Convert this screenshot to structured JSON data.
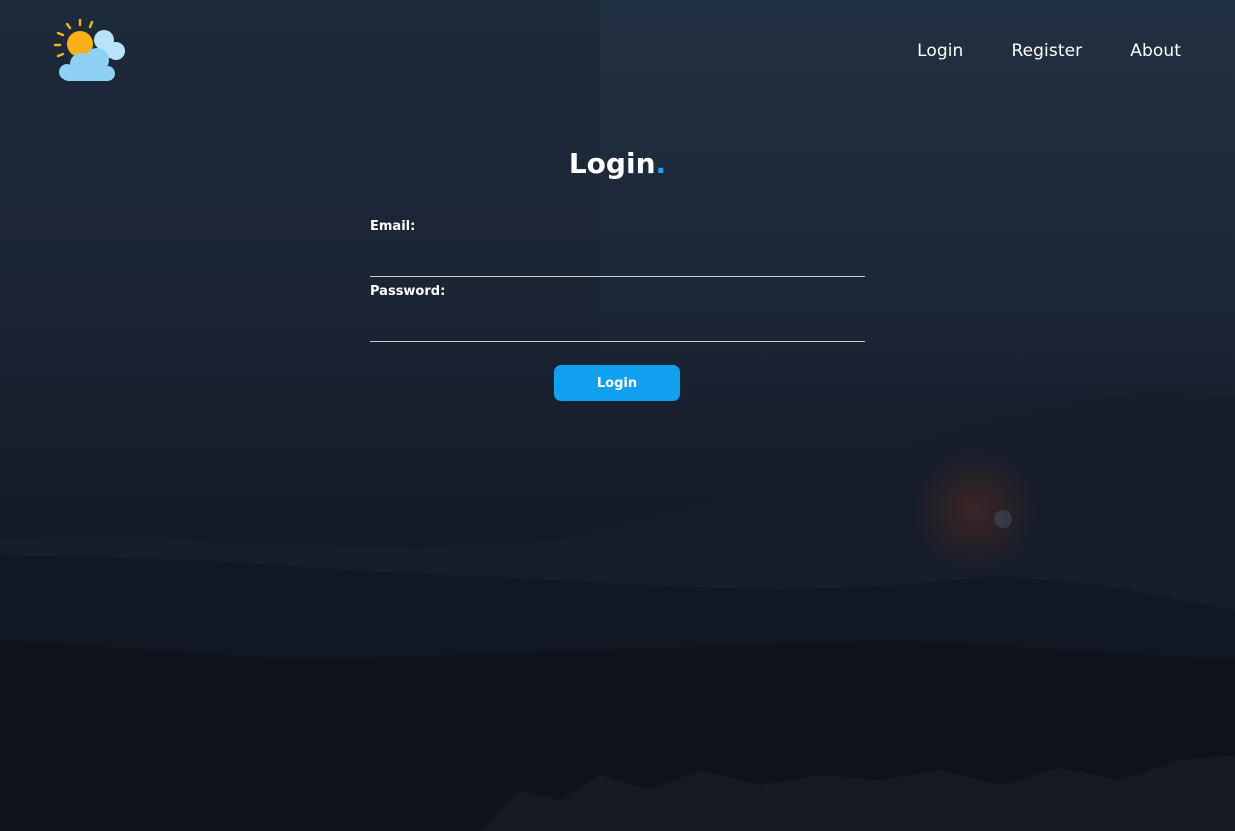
{
  "header": {
    "logo_icon": "weather-sun-cloud-icon",
    "nav": [
      {
        "label": "Login"
      },
      {
        "label": "Register"
      },
      {
        "label": "About"
      }
    ]
  },
  "login": {
    "title": "Login",
    "title_dot": ".",
    "email_label": "Email:",
    "email_value": "",
    "password_label": "Password:",
    "password_value": "",
    "submit_label": "Login"
  },
  "colors": {
    "accent": "#11a0f0",
    "title_dot": "#1fa2ff",
    "background_top": "#1d2a3b",
    "background_bottom": "#0c111a",
    "sun": "#fbb116",
    "cloud": "#8fd0f5"
  }
}
